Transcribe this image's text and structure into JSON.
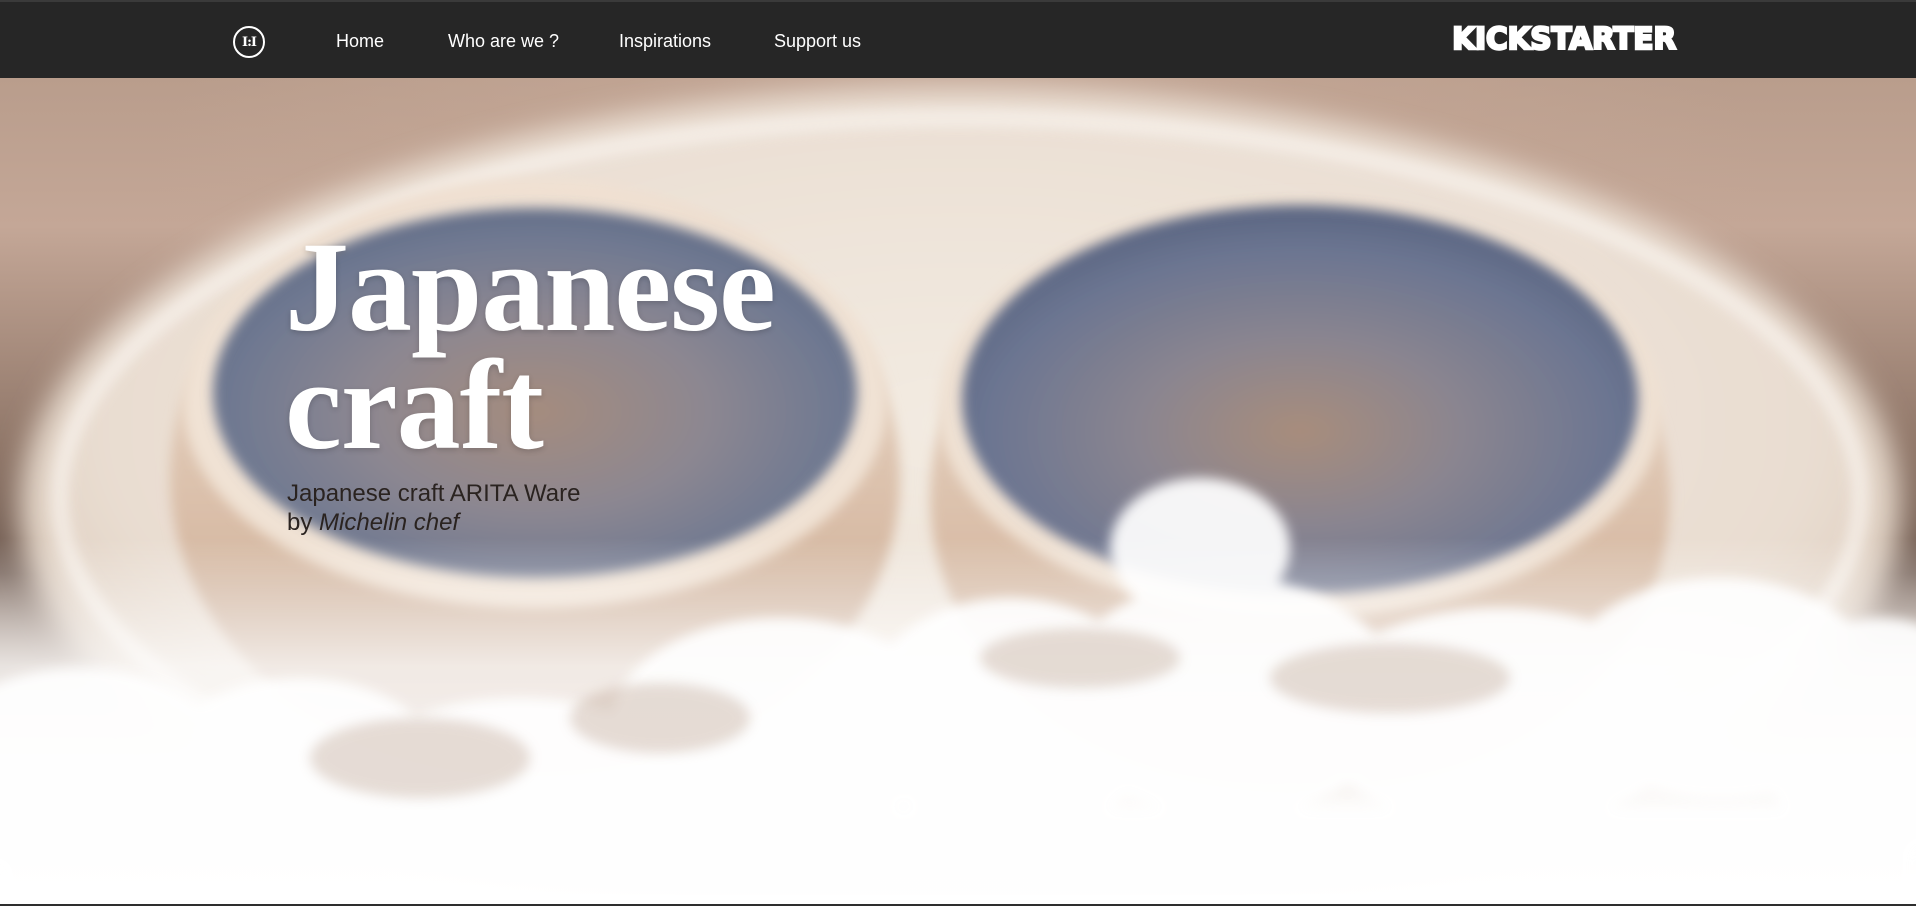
{
  "header": {
    "logo_text": "I:I",
    "nav": [
      {
        "label": "Home"
      },
      {
        "label": "Who are we ?"
      },
      {
        "label": "Inspirations"
      },
      {
        "label": "Support us"
      }
    ],
    "brand": "KICKSTARTER"
  },
  "hero": {
    "title_line1": "Japanese",
    "title_line2": "craft",
    "subtitle_line1": "Japanese craft ARITA Ware",
    "subtitle_by": "by ",
    "subtitle_emph": "Michelin chef"
  },
  "colors": {
    "header_bg": "#262626",
    "header_text": "#ffffff",
    "title_color": "#ffffff",
    "subtitle_color": "#2a2320"
  }
}
